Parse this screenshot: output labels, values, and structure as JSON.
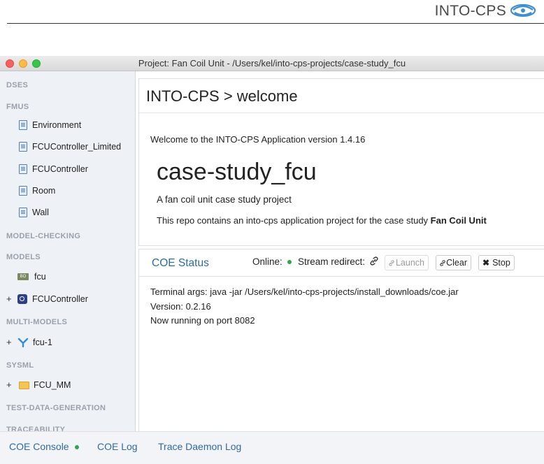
{
  "header": {
    "logo_text": "INTO-CPS",
    "logo_icon": "into-cps-logo-icon"
  },
  "window": {
    "title": "Project: Fan Coil Unit - /Users/kel/into-cps-projects/case-study_fcu"
  },
  "sidebar": {
    "sections": {
      "dses": "DSES",
      "fmus": "FMUS",
      "model_checking": "MODEL-CHECKING",
      "models": "MODELS",
      "multi_models": "MULTI-MODELS",
      "sysml": "SYSML",
      "test_data": "TEST-DATA-GENERATION",
      "traceability": "TRACEABILITY"
    },
    "fmus": [
      "Environment",
      "FCUController_Limited",
      "FCUController",
      "Room",
      "Wall"
    ],
    "models": [
      {
        "label": "fcu",
        "icon": "fmu-file-icon",
        "expandable": false
      },
      {
        "label": "FCUController",
        "icon": "fcucontroller-icon",
        "expandable": true
      }
    ],
    "multi_models": [
      {
        "label": "fcu-1",
        "icon": "multimodel-icon",
        "expandable": true
      }
    ],
    "sysml": [
      {
        "label": "FCU_MM",
        "icon": "folder-icon",
        "expandable": true
      }
    ],
    "expand_symbol": "+"
  },
  "welcome": {
    "heading": "INTO-CPS > welcome",
    "welcome_text": "Welcome to the INTO-CPS Application version 1.4.16",
    "project_name": "case-study_fcu",
    "project_desc": "A fan coil unit case study project",
    "repo_line_prefix": "This repo contains an into-cps application project for the case study ",
    "repo_line_bold": "Fan Coil Unit"
  },
  "coe": {
    "title": "COE Status",
    "online_label": "Online:",
    "online_status_color": "#2aa84a",
    "stream_label": "Stream redirect:",
    "launch_label": "Launch",
    "clear_label": "Clear",
    "stop_label": "Stop",
    "terminal_lines": [
      "Terminal args: java -jar /Users/kel/into-cps-projects/install_downloads/coe.jar",
      "Version: 0.2.16",
      "Now running on port 8082"
    ]
  },
  "bottombar": {
    "coe_console": "COE Console",
    "coe_log": "COE Log",
    "trace_daemon_log": "Trace Daemon Log"
  },
  "colors": {
    "link": "#2d6ca3",
    "sidebar_bg": "#eef1f6",
    "section_text": "#9aa1ab"
  }
}
